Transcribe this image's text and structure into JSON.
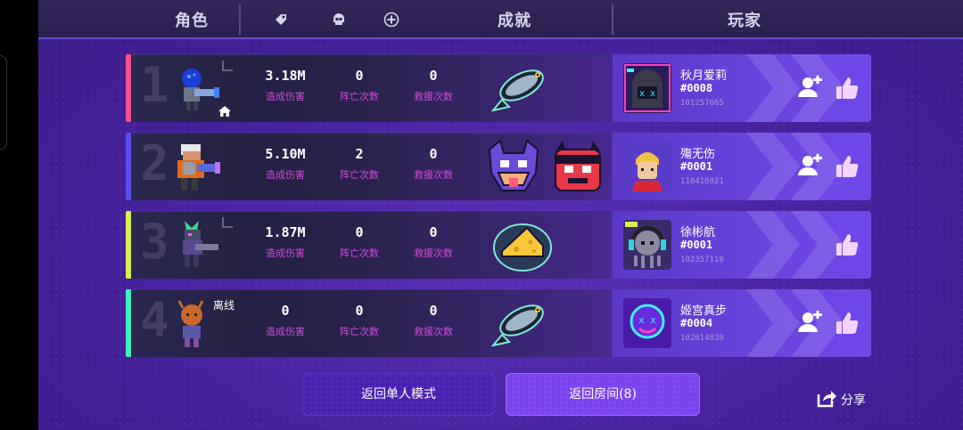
{
  "header": {
    "character": "角色",
    "achievement": "成就",
    "player": "玩家",
    "icons": [
      "tag-icon",
      "skull-icon",
      "heal-plus-icon"
    ]
  },
  "rows": [
    {
      "rank": "1",
      "accent": "#ff4f8a",
      "character_sprite": "blue-helmet-gunner",
      "char_badge": "home-icon",
      "stats": [
        {
          "value": "3.18M",
          "label": "造成伤害"
        },
        {
          "value": "0",
          "label": "阵亡次数"
        },
        {
          "value": "0",
          "label": "救援次数"
        }
      ],
      "achievements": [
        "fish-icon"
      ],
      "player": {
        "name": "秋月爱莉",
        "tag": "#0008",
        "id": "101257665",
        "avatar": "hooded-neon-avatar",
        "can_add": true
      }
    },
    {
      "rank": "2",
      "accent": "#5a4cf0",
      "character_sprite": "engineer-robot-gunner",
      "stats": [
        {
          "value": "5.10M",
          "label": "造成伤害"
        },
        {
          "value": "2",
          "label": "阵亡次数"
        },
        {
          "value": "0",
          "label": "救援次数"
        }
      ],
      "achievements": [
        "wolf-icon",
        "devil-icon"
      ],
      "player": {
        "name": "殤无伤",
        "tag": "#0001",
        "id": "110416921",
        "avatar": "blonde-boy-avatar",
        "can_add": true
      }
    },
    {
      "rank": "3",
      "accent": "#d7f050",
      "character_sprite": "green-armored-gunner",
      "stats": [
        {
          "value": "1.87M",
          "label": "造成伤害"
        },
        {
          "value": "0",
          "label": "阵亡次数"
        },
        {
          "value": "0",
          "label": "救援次数"
        }
      ],
      "achievements": [
        "cheese-icon"
      ],
      "player": {
        "name": "徐彬航",
        "tag": "#0001",
        "id": "102357110",
        "avatar": "octopus-headphones-avatar",
        "can_add": false
      }
    },
    {
      "rank": "4",
      "accent": "#3ff0b8",
      "character_sprite": "pumpkin-head-hero",
      "char_tag": "离线",
      "stats": [
        {
          "value": "0",
          "label": "造成伤害"
        },
        {
          "value": "0",
          "label": "阵亡次数"
        },
        {
          "value": "0",
          "label": "救援次数"
        }
      ],
      "achievements": [
        "fish-icon"
      ],
      "player": {
        "name": "姬宫真步",
        "tag": "#0004",
        "id": "102014830",
        "avatar": "neon-smiley-avatar",
        "can_add": true
      }
    }
  ],
  "buttons": {
    "single_mode": "返回单人模式",
    "room": "返回房间(8)",
    "share": "分享"
  }
}
